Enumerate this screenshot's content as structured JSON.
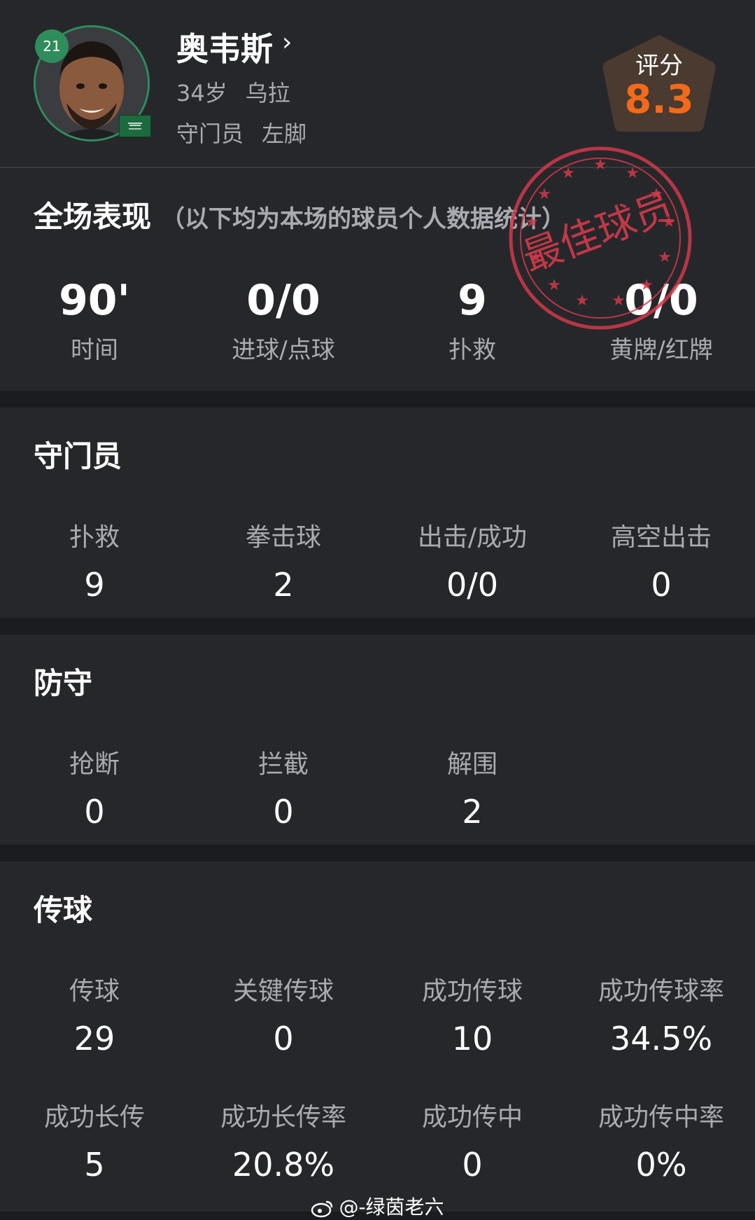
{
  "player": {
    "number": "21",
    "name": "奥韦斯",
    "age": "34岁",
    "country": "乌拉",
    "position": "守门员",
    "foot": "左脚"
  },
  "rating": {
    "label": "评分",
    "value": "8.3"
  },
  "colors": {
    "accent": "#2f8d5c",
    "rating": "#f26a1b",
    "stamp": "#d23a4a"
  },
  "overall": {
    "title": "全场表现",
    "note": "（以下均为本场的球员个人数据统计）",
    "stamp_text": "最佳球员",
    "stats": [
      {
        "value": "90'",
        "label": "时间"
      },
      {
        "value": "0/0",
        "label": "进球/点球"
      },
      {
        "value": "9",
        "label": "扑救"
      },
      {
        "value": "0/0",
        "label": "黄牌/红牌"
      }
    ]
  },
  "goalkeeper": {
    "title": "守门员",
    "stats": [
      {
        "label": "扑救",
        "value": "9"
      },
      {
        "label": "拳击球",
        "value": "2"
      },
      {
        "label": "出击/成功",
        "value": "0/0"
      },
      {
        "label": "高空出击",
        "value": "0"
      }
    ]
  },
  "defense": {
    "title": "防守",
    "stats": [
      {
        "label": "抢断",
        "value": "0"
      },
      {
        "label": "拦截",
        "value": "0"
      },
      {
        "label": "解围",
        "value": "2"
      }
    ]
  },
  "passing": {
    "title": "传球",
    "row1": [
      {
        "label": "传球",
        "value": "29"
      },
      {
        "label": "关键传球",
        "value": "0"
      },
      {
        "label": "成功传球",
        "value": "10"
      },
      {
        "label": "成功传球率",
        "value": "34.5%"
      }
    ],
    "row2": [
      {
        "label": "成功长传",
        "value": "5"
      },
      {
        "label": "成功长传率",
        "value": "20.8%"
      },
      {
        "label": "成功传中",
        "value": "0"
      },
      {
        "label": "成功传中率",
        "value": "0%"
      }
    ]
  },
  "watermark": "@-绿茵老六"
}
